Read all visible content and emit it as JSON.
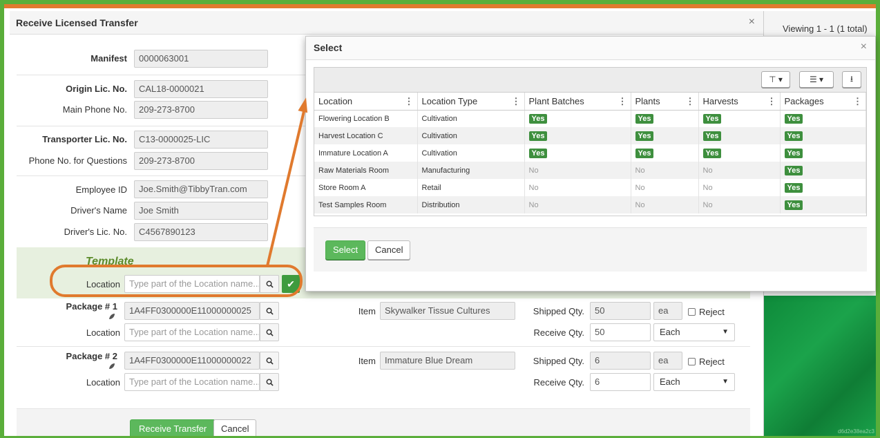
{
  "background": {
    "viewing_text": "Viewing 1 - 1 (1 total)",
    "hash_text": "d6d2e38ea2c3"
  },
  "dialog": {
    "title": "Receive Licensed Transfer",
    "close_icon": "×",
    "fields": {
      "manifest": {
        "label": "Manifest",
        "value": "0000063001"
      },
      "origin_lic": {
        "label": "Origin Lic. No.",
        "value": "CAL18-0000021"
      },
      "main_phone": {
        "label": "Main Phone No.",
        "value": "209-273-8700"
      },
      "transporter_lic": {
        "label": "Transporter Lic. No.",
        "value": "C13-0000025-LIC"
      },
      "phone_questions": {
        "label": "Phone No. for Questions",
        "value": "209-273-8700"
      },
      "employee_id": {
        "label": "Employee ID",
        "value": "Joe.Smith@TibbyTran.com"
      },
      "driver_name": {
        "label": "Driver's Name",
        "value": "Joe Smith"
      },
      "driver_lic": {
        "label": "Driver's Lic. No.",
        "value": "C4567890123"
      }
    },
    "template": {
      "title": "Template",
      "location_label": "Location",
      "location_placeholder": "Type part of the Location name..."
    },
    "packages": [
      {
        "label": "Package # 1",
        "tag": "1A4FF0300000E11000000025",
        "location_label": "Location",
        "location_placeholder": "Type part of the Location name...",
        "item_label": "Item",
        "item": "Skywalker Tissue Cultures",
        "shipped_label": "Shipped Qty.",
        "shipped_qty": "50",
        "shipped_unit": "ea",
        "reject_label": "Reject",
        "receive_label": "Receive Qty.",
        "receive_qty": "50",
        "receive_unit": "Each"
      },
      {
        "label": "Package # 2",
        "tag": "1A4FF0300000E11000000022",
        "location_label": "Location",
        "location_placeholder": "Type part of the Location name...",
        "item_label": "Item",
        "item": "Immature Blue Dream",
        "shipped_label": "Shipped Qty.",
        "shipped_qty": "6",
        "shipped_unit": "ea",
        "reject_label": "Reject",
        "receive_label": "Receive Qty.",
        "receive_qty": "6",
        "receive_unit": "Each"
      }
    ],
    "buttons": {
      "receive": "Receive Transfer",
      "cancel": "Cancel"
    }
  },
  "modal": {
    "title": "Select",
    "close_icon": "×",
    "columns": [
      "Location",
      "Location Type",
      "Plant Batches",
      "Plants",
      "Harvests",
      "Packages"
    ],
    "rows": [
      {
        "location": "Flowering Location B",
        "type": "Cultivation",
        "plant_batches": "Yes",
        "plants": "Yes",
        "harvests": "Yes",
        "packages": "Yes"
      },
      {
        "location": "Harvest Location C",
        "type": "Cultivation",
        "plant_batches": "Yes",
        "plants": "Yes",
        "harvests": "Yes",
        "packages": "Yes"
      },
      {
        "location": "Immature Location A",
        "type": "Cultivation",
        "plant_batches": "Yes",
        "plants": "Yes",
        "harvests": "Yes",
        "packages": "Yes"
      },
      {
        "location": "Raw Materials Room",
        "type": "Manufacturing",
        "plant_batches": "No",
        "plants": "No",
        "harvests": "No",
        "packages": "Yes"
      },
      {
        "location": "Store Room A",
        "type": "Retail",
        "plant_batches": "No",
        "plants": "No",
        "harvests": "No",
        "packages": "Yes"
      },
      {
        "location": "Test Samples Room",
        "type": "Distribution",
        "plant_batches": "No",
        "plants": "No",
        "harvests": "No",
        "packages": "Yes"
      }
    ],
    "buttons": {
      "select": "Select",
      "cancel": "Cancel"
    }
  },
  "colors": {
    "border_green": "#5aae3a",
    "accent_orange": "#e07a2e",
    "yes_badge": "#3e8f3e",
    "button_green": "#5cb85c"
  }
}
